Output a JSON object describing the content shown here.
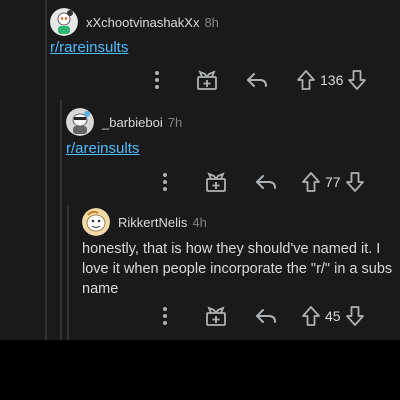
{
  "colors": {
    "background": "#1a1a1b",
    "thread_line": "#343536",
    "text": "#d7dadc",
    "muted": "#818384",
    "link": "#4fbcff",
    "icon": "#aeb1b3"
  },
  "comments": [
    {
      "username": "xXchootvinashakXx",
      "age": "8h",
      "body": "r/rareinsults",
      "votes": "136",
      "icons": [
        "more-icon",
        "award-icon",
        "reply-icon",
        "upvote-icon",
        "downvote-icon"
      ]
    },
    {
      "username": "_barbieboi",
      "age": "7h",
      "body": "r/areinsults",
      "votes": "77",
      "icons": [
        "more-icon",
        "award-icon",
        "reply-icon",
        "upvote-icon",
        "downvote-icon"
      ]
    },
    {
      "username": "RikkertNelis",
      "age": "4h",
      "body_lines": [
        "honestly, that is how they should've named it. I",
        "love it when people incorporate the \"r/\" in a subs",
        "name"
      ],
      "votes": "45",
      "icons": [
        "more-icon",
        "award-icon",
        "reply-icon",
        "upvote-icon",
        "downvote-icon"
      ]
    }
  ]
}
